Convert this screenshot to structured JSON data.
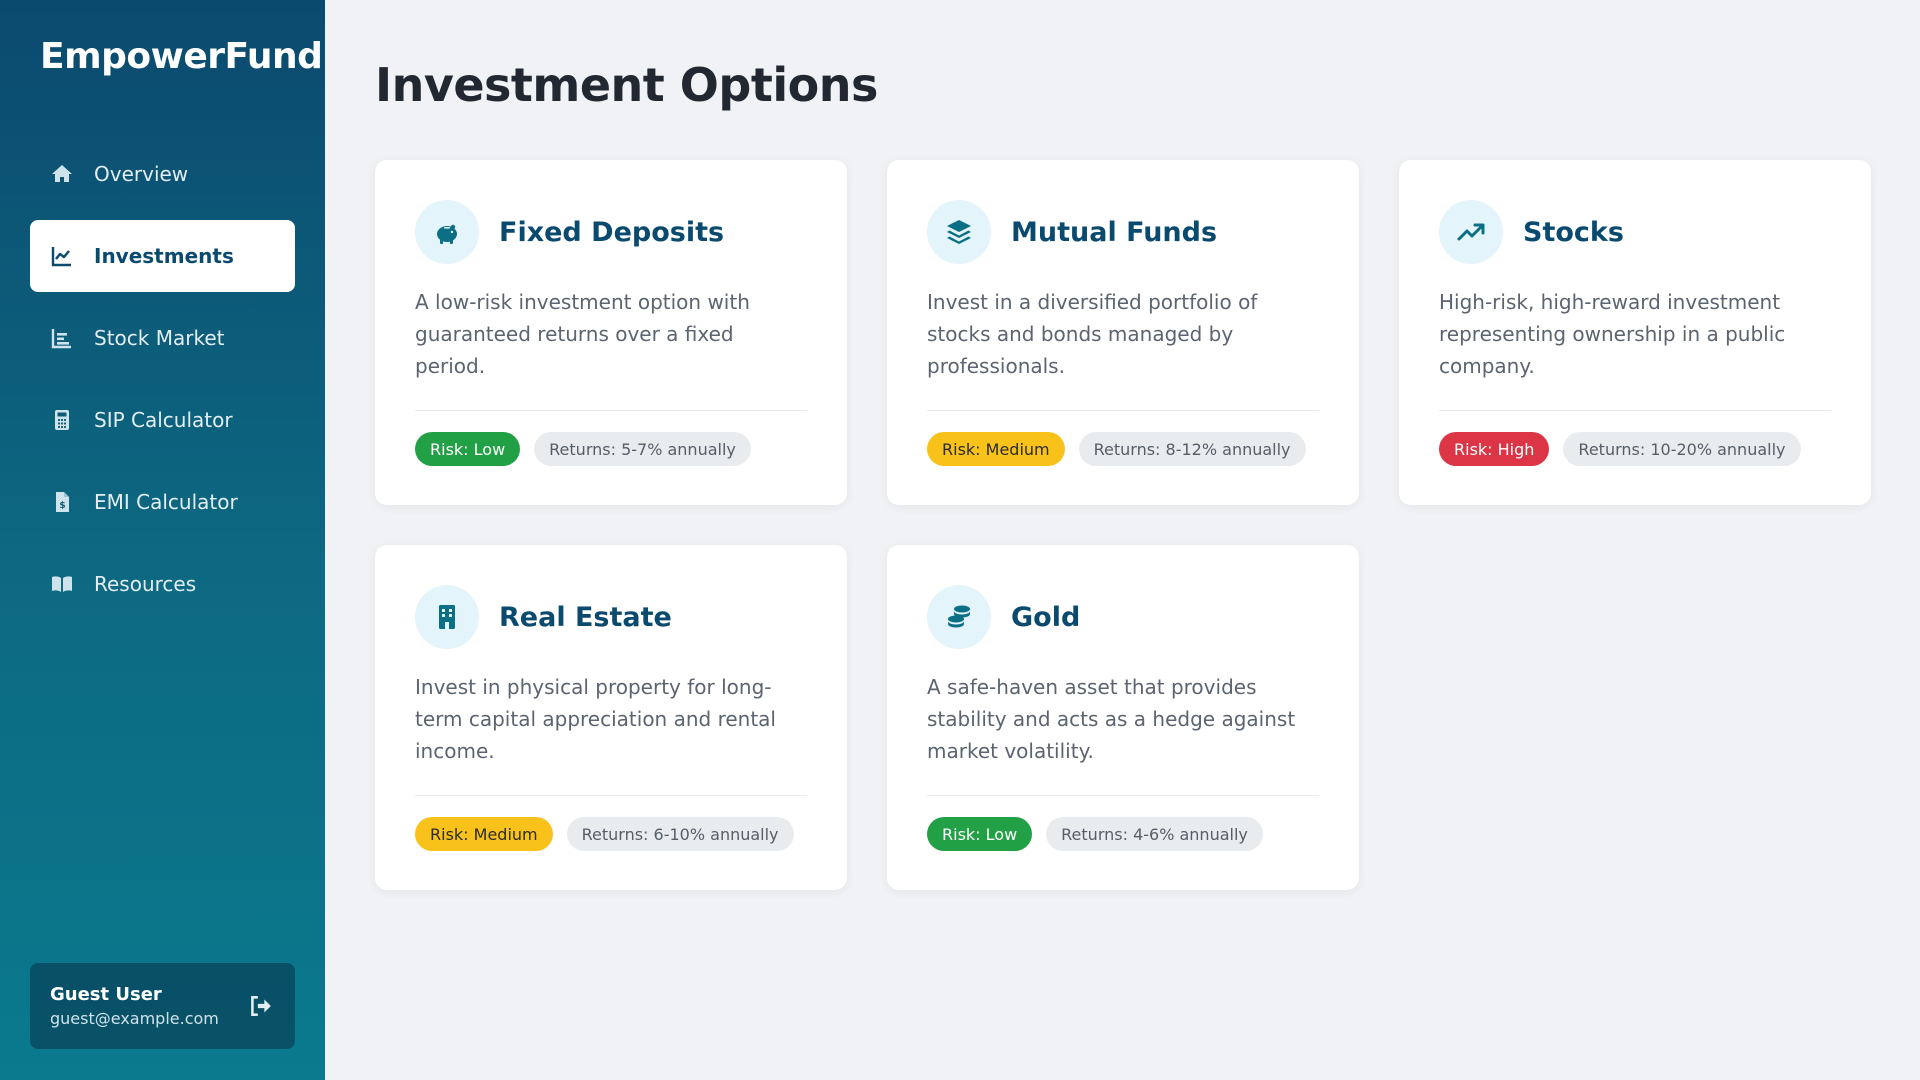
{
  "app": {
    "brand": "EmpowerFund"
  },
  "sidebar": {
    "items": [
      {
        "label": "Overview",
        "icon": "home-icon",
        "active": false
      },
      {
        "label": "Investments",
        "icon": "chart-line-icon",
        "active": true
      },
      {
        "label": "Stock Market",
        "icon": "bar-chart-icon",
        "active": false
      },
      {
        "label": "SIP Calculator",
        "icon": "calculator-icon",
        "active": false
      },
      {
        "label": "EMI Calculator",
        "icon": "invoice-dollar-icon",
        "active": false
      },
      {
        "label": "Resources",
        "icon": "book-icon",
        "active": false
      }
    ],
    "user": {
      "name": "Guest User",
      "email": "guest@example.com",
      "logout_icon": "logout-icon"
    }
  },
  "main": {
    "title": "Investment Options",
    "cards": [
      {
        "title": "Fixed Deposits",
        "icon": "piggy-bank-icon",
        "description": "A low-risk investment option with guaranteed returns over a fixed period.",
        "risk": "Risk: Low",
        "risk_level": "low",
        "returns": "Returns: 5-7% annually"
      },
      {
        "title": "Mutual Funds",
        "icon": "layers-icon",
        "description": "Invest in a diversified portfolio of stocks and bonds managed by professionals.",
        "risk": "Risk: Medium",
        "risk_level": "medium",
        "returns": "Returns: 8-12% annually"
      },
      {
        "title": "Stocks",
        "icon": "trending-up-icon",
        "description": "High-risk, high-reward investment representing ownership in a public company.",
        "risk": "Risk: High",
        "risk_level": "high",
        "returns": "Returns: 10-20% annually"
      },
      {
        "title": "Real Estate",
        "icon": "building-icon",
        "description": "Invest in physical property for long-term capital appreciation and rental income.",
        "risk": "Risk: Medium",
        "risk_level": "medium",
        "returns": "Returns: 6-10% annually"
      },
      {
        "title": "Gold",
        "icon": "coins-icon",
        "description": "A safe-haven asset that provides stability and acts as a hedge against market volatility.",
        "risk": "Risk: Low",
        "risk_level": "low",
        "returns": "Returns: 4-6% annually"
      }
    ]
  },
  "colors": {
    "brand_dark": "#0b4a6f",
    "brand_teal": "#0a7a8e",
    "risk_low": "#22a046",
    "risk_medium": "#f8c21a",
    "risk_high": "#dc3545"
  }
}
